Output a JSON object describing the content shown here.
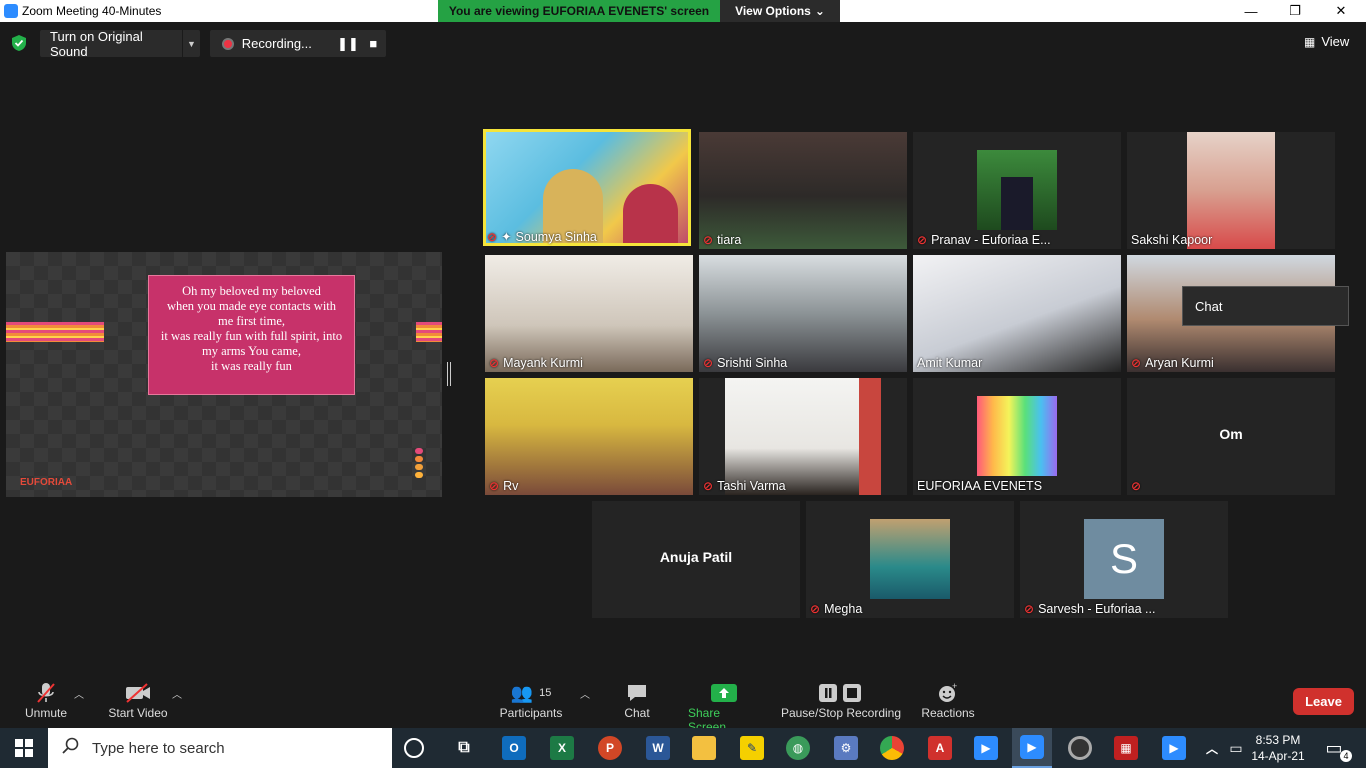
{
  "window": {
    "title": "Zoom Meeting 40-Minutes",
    "minimize": "—",
    "maximize": "❐",
    "close": "✕"
  },
  "banner": {
    "viewing_text": "You are viewing EUFORIAA EVENETS' screen",
    "view_options": "View Options"
  },
  "top_toolbar": {
    "original_sound": "Turn on Original Sound",
    "recording": "Recording...",
    "view_label": "View"
  },
  "share": {
    "lines": [
      "Oh my beloved my beloved",
      "when you made eye contacts with",
      "me first time,",
      "it was really fun with full spirit, into",
      "my arms You came,",
      "it was really fun"
    ],
    "logo": "EUFORIAA"
  },
  "participants": [
    {
      "name": "Soumya Sinha",
      "muted": true,
      "pinned": true
    },
    {
      "name": "tiara",
      "muted": true
    },
    {
      "name": "Pranav - Euforiaa E...",
      "muted": true
    },
    {
      "name": "Sakshi Kapoor",
      "muted": false
    },
    {
      "name": "Mayank Kurmi",
      "muted": true
    },
    {
      "name": "Srishti Sinha",
      "muted": true
    },
    {
      "name": "Amit Kumar",
      "muted": false
    },
    {
      "name": "Aryan Kurmi",
      "muted": true
    },
    {
      "name": "Rv",
      "muted": true
    },
    {
      "name": "Tashi Varma",
      "muted": true
    },
    {
      "name": "EUFORIAA EVENETS",
      "muted": false
    },
    {
      "name": "Om",
      "muted": true
    },
    {
      "name": "Anuja Patil",
      "muted": false
    },
    {
      "name": "Megha",
      "muted": true
    },
    {
      "name": "Sarvesh - Euforiaa ...",
      "muted": true,
      "avatar_letter": "S"
    }
  ],
  "chat_tooltip": "Chat",
  "bottom_toolbar": {
    "unmute": "Unmute",
    "start_video": "Start Video",
    "participants": "Participants",
    "participants_count": "15",
    "chat": "Chat",
    "share_screen": "Share Screen",
    "pause_stop": "Pause/Stop Recording",
    "reactions": "Reactions",
    "leave": "Leave"
  },
  "taskbar": {
    "search_placeholder": "Type here to search",
    "time": "8:53 PM",
    "date": "14-Apr-21",
    "notifications": "4"
  },
  "colors": {
    "share_green": "#25a244",
    "leave_red": "#d0312d",
    "active_speaker": "#f5e43b",
    "zoom_blue": "#2d8cff"
  }
}
